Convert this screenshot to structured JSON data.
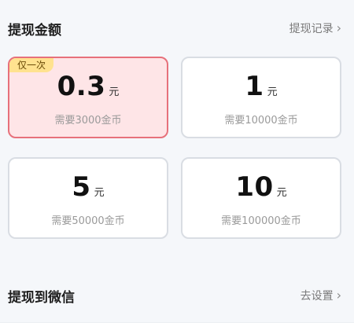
{
  "header": {
    "title": "提现金额",
    "link_label": "提现记录"
  },
  "cards": [
    {
      "amount": "0.3",
      "unit": "元",
      "cost": "需要3000金币",
      "badge": "仅一次"
    },
    {
      "amount": "1",
      "unit": "元",
      "cost": "需要10000金币"
    },
    {
      "amount": "5",
      "unit": "元",
      "cost": "需要50000金币"
    },
    {
      "amount": "10",
      "unit": "元",
      "cost": "需要100000金币"
    }
  ],
  "wechat": {
    "title": "提现到微信",
    "link_label": "去设置"
  },
  "icons": {
    "chevron": "chevron-right-icon"
  },
  "colors": {
    "selected_bg": "#fee5e7",
    "selected_border": "#e7717b",
    "badge_bg": "#ffe28f"
  }
}
